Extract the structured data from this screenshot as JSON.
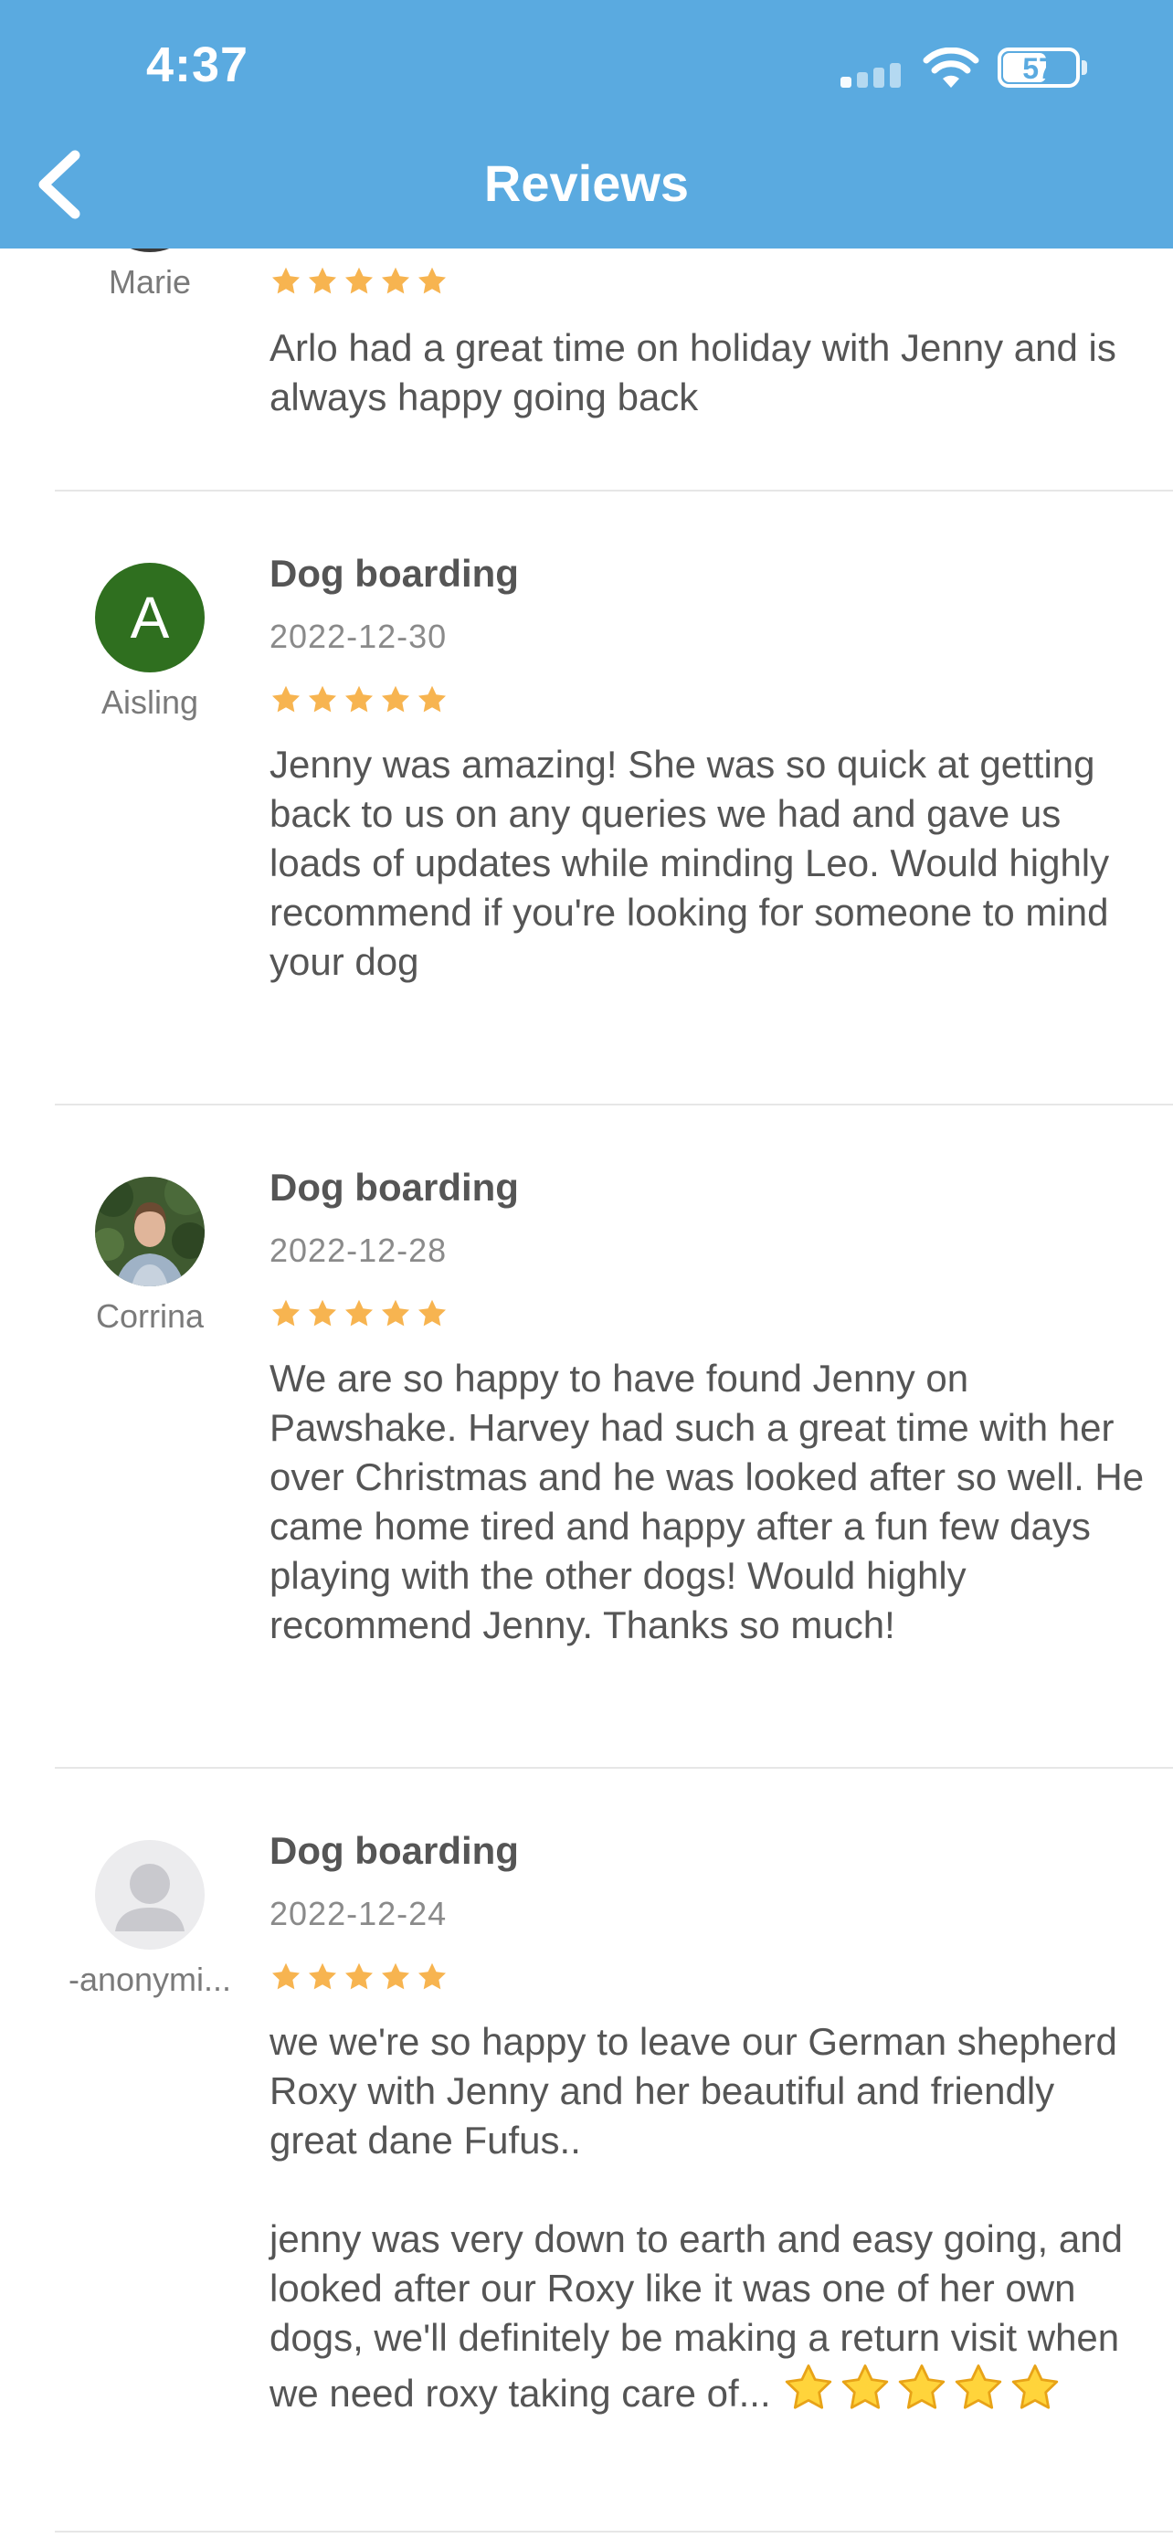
{
  "status_bar": {
    "time": "4:37",
    "battery": "57"
  },
  "nav": {
    "title": "Reviews"
  },
  "colors": {
    "header": "#5aaae0",
    "star": "#f7b450",
    "aisling_avatar": "#2f6f1f"
  },
  "reviews": [
    {
      "reviewer": "Marie",
      "rating": 5,
      "text": "Arlo had a great time on holiday with Jenny and is always happy going back"
    },
    {
      "reviewer": "Aisling",
      "avatar_letter": "A",
      "service": "Dog boarding",
      "date": "2022-12-30",
      "rating": 5,
      "text": "Jenny was amazing! She was so quick at getting back to us on any queries we had and gave us loads of updates while minding Leo. Would highly recommend if you're looking for someone to mind your dog"
    },
    {
      "reviewer": "Corrina",
      "service": "Dog boarding",
      "date": "2022-12-28",
      "rating": 5,
      "text": "We are so happy to have found Jenny on Pawshake. Harvey had such a great time with her over Christmas and he was looked after so well. He came home tired and happy after a fun few days playing with the other dogs! Would highly recommend Jenny. Thanks so much!"
    },
    {
      "reviewer": "-anonymi...",
      "service": "Dog boarding",
      "date": "2022-12-24",
      "rating": 5,
      "text": "we we're so happy to leave our German shepherd Roxy with Jenny and her beautiful and friendly great dane Fufus..",
      "text2": "jenny was very down to earth and easy going, and looked after our Roxy like it was one of her own dogs, we'll definitely be making a return visit when we need roxy taking care of..."
    }
  ]
}
